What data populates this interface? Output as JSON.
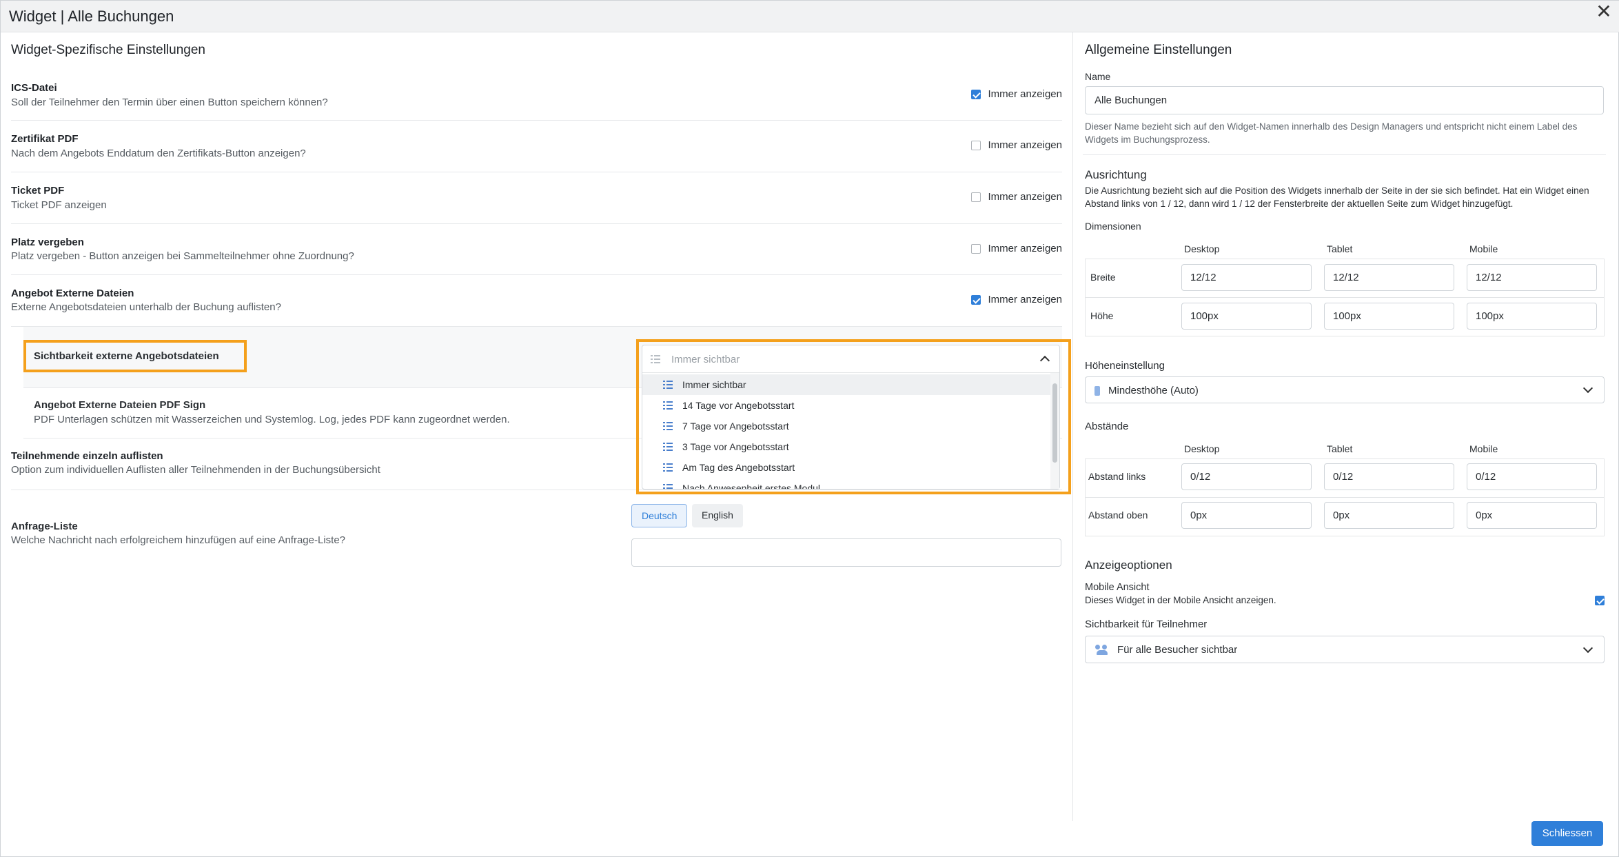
{
  "header": {
    "title": "Widget | Alle Buchungen"
  },
  "left": {
    "section_title": "Widget-Spezifische Einstellungen",
    "checkbox_label": "Immer anzeigen",
    "settings": [
      {
        "title": "ICS-Datei",
        "desc": "Soll der Teilnehmer den Termin über einen Button speichern können?",
        "checked": true
      },
      {
        "title": "Zertifikat PDF",
        "desc": "Nach dem Angebots Enddatum den Zertifikats-Button anzeigen?",
        "checked": false
      },
      {
        "title": "Ticket PDF",
        "desc": "Ticket PDF anzeigen",
        "checked": false
      },
      {
        "title": "Platz vergeben",
        "desc": "Platz vergeben - Button anzeigen bei Sammelteilnehmer ohne Zuordnung?",
        "checked": false
      },
      {
        "title": "Angebot Externe Dateien",
        "desc": "Externe Angebotsdateien unterhalb der Buchung auflisten?",
        "checked": true
      }
    ],
    "visibility": {
      "label": "Sichtbarkeit externe Angebotsdateien",
      "placeholder": "Immer sichtbar",
      "options": [
        "Immer sichtbar",
        "14 Tage vor Angebotsstart",
        "7 Tage vor Angebotsstart",
        "3 Tage vor Angebotsstart",
        "Am Tag des Angebotsstart",
        "Nach Anwesenheit erstes Modul"
      ]
    },
    "pdf_sign": {
      "title": "Angebot Externe Dateien PDF Sign",
      "desc": "PDF Unterlagen schützen mit Wasserzeichen und Systemlog. Log, jedes PDF kann zugeordnet werden."
    },
    "list_participants": {
      "title": "Teilnehmende einzeln auflisten",
      "desc": "Option zum individuellen Auflisten aller Teilnehmenden in der Buchungsübersicht"
    },
    "request_list": {
      "title": "Anfrage-Liste",
      "desc": "Welche Nachricht nach erfolgreichem hinzufügen auf eine Anfrage-Liste?",
      "lang_de": "Deutsch",
      "lang_en": "English",
      "value": ""
    }
  },
  "right": {
    "section_title": "Allgemeine Einstellungen",
    "name_label": "Name",
    "name_value": "Alle Buchungen",
    "name_help": "Dieser Name bezieht sich auf den Widget-Namen innerhalb des Design Managers und entspricht nicht einem Label des Widgets im Buchungsprozess.",
    "alignment_title": "Ausrichtung",
    "alignment_help": "Die Ausrichtung bezieht sich auf die Position des Widgets innerhalb der Seite in der sie sich befindet. Hat ein Widget einen Abstand links von 1 / 12, dann wird 1 / 12 der Fensterbreite der aktuellen Seite zum Widget hinzugefügt.",
    "dimensions_title": "Dimensionen",
    "columns": [
      "Desktop",
      "Tablet",
      "Mobile"
    ],
    "dimensions": [
      {
        "label": "Breite",
        "values": [
          "12/12",
          "12/12",
          "12/12"
        ]
      },
      {
        "label": "Höhe",
        "values": [
          "100px",
          "100px",
          "100px"
        ]
      }
    ],
    "height_setting_title": "Höheneinstellung",
    "height_setting_value": "Mindesthöhe (Auto)",
    "spacing_title": "Abstände",
    "spacing": [
      {
        "label": "Abstand links",
        "values": [
          "0/12",
          "0/12",
          "0/12"
        ]
      },
      {
        "label": "Abstand oben",
        "values": [
          "0px",
          "0px",
          "0px"
        ]
      }
    ],
    "display_title": "Anzeigeoptionen",
    "mobile_view_title": "Mobile Ansicht",
    "mobile_view_desc": "Dieses Widget in der Mobile Ansicht anzeigen.",
    "mobile_view_checked": true,
    "visibility_title": "Sichtbarkeit für Teilnehmer",
    "visibility_value": "Für alle Besucher sichtbar"
  },
  "footer": {
    "close_label": "Schliessen"
  },
  "colors": {
    "accent": "#2f7fd9",
    "highlight": "#f4a01c"
  }
}
